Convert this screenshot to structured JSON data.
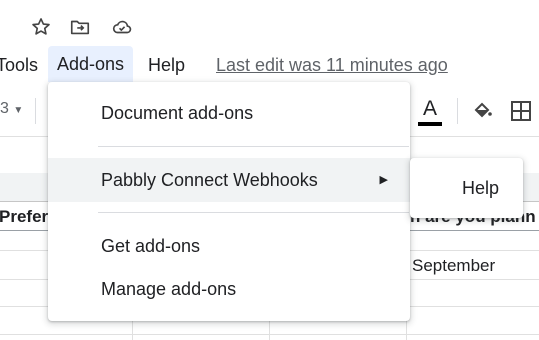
{
  "top_icons": {
    "star": "star-icon",
    "move": "move-to-folder-icon",
    "cloud": "cloud-saved-icon"
  },
  "menubar": {
    "tools": "Tools",
    "addons": "Add-ons",
    "help": "Help",
    "last_edit": "Last edit was 11 minutes ago"
  },
  "toolbar": {
    "font_size": "3",
    "text_color_letter": "A",
    "text_color": "#000000"
  },
  "sheet": {
    "cell_b": "Prefer",
    "cell_e": "n are you plann",
    "cell_e2": "September"
  },
  "addons_menu": {
    "items": [
      {
        "label": "Document add-ons"
      },
      {
        "label": "Pabbly Connect Webhooks",
        "submenu_arrow": "▶"
      },
      {
        "label": "Get add-ons"
      },
      {
        "label": "Manage add-ons"
      }
    ],
    "submenu": {
      "items": [
        {
          "label": "Help"
        }
      ]
    }
  },
  "colors": {
    "accent_active": "#e8f0fe",
    "menu_hover": "#f1f3f4"
  }
}
